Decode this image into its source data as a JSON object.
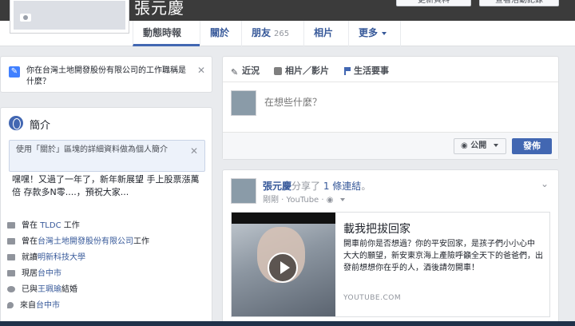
{
  "header": {
    "name": "張元慶",
    "update_info_label": "更新資料",
    "activity_log_label": "查看活動記錄"
  },
  "nav": {
    "tabs": [
      {
        "label": "動態時報"
      },
      {
        "label": "關於"
      },
      {
        "label": "朋友",
        "count": "265"
      },
      {
        "label": "相片"
      },
      {
        "label": "更多"
      }
    ]
  },
  "job_prompt": {
    "text": "你在台灣土地開發股份有限公司的工作職稱是什麼？"
  },
  "intro": {
    "title": "簡介",
    "tip": "使用「關於」區塊的詳細資料做為個人簡介",
    "bio": "嘿嘿！又過了一年了，新年新展望 手上股票漲萬倍 存款多N零....，預祝大家...",
    "items": [
      {
        "prefix": "曾在",
        "link": "TLDC",
        "suffix": "工作"
      },
      {
        "prefix": "曾在",
        "link": "台灣土地開發股份有限公司",
        "suffix": "工作"
      },
      {
        "prefix": "就讀",
        "link": "明新科技大學",
        "suffix": ""
      },
      {
        "prefix": "現居",
        "link": "台中市",
        "suffix": ""
      },
      {
        "prefix": "已與",
        "link": "王珮瑜",
        "suffix": "結婚"
      },
      {
        "prefix": "來自",
        "link": "台中市",
        "suffix": ""
      }
    ]
  },
  "composer": {
    "tab_status": "近況",
    "tab_photo": "相片／影片",
    "tab_event": "生活要事",
    "placeholder": "在想些什麼？",
    "privacy_label": "公開",
    "post_label": "發佈"
  },
  "story": {
    "actor": "張元慶",
    "action": "分享了",
    "object_link": "1 條連結",
    "period": "。",
    "time": "剛剛",
    "source": "YouTube",
    "card": {
      "title": "載我把拔回家",
      "description": "開車前你是否想過？你的平安回家，是孩子們小小心中 大大的願望，新安東京海上產險呼籲全天下的爸爸們，出發前想想你在乎的人，酒後請勿開車！",
      "domain": "YOUTUBE.COM"
    }
  },
  "colors": {
    "link": "#365899",
    "primary_button": "#4267b2",
    "page_bg": "#e9ebee"
  }
}
